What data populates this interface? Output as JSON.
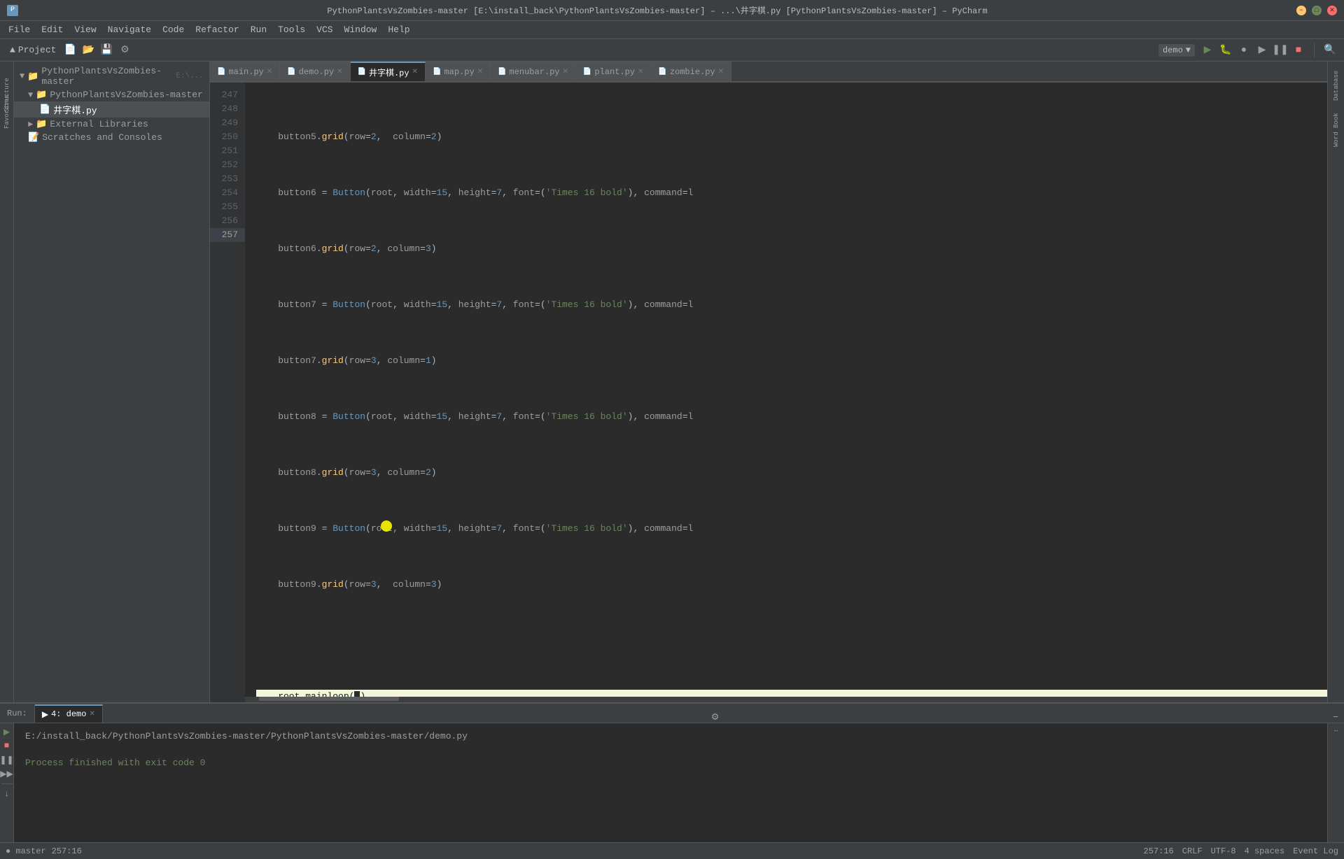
{
  "titlebar": {
    "title": "PythonPlantsVsZombies-master [E:\\install_back\\PythonPlantsVsZombies-master] – ...\\井字棋.py [PythonPlantsVsZombies-master] – PyCharm",
    "app": "PyCharm"
  },
  "menubar": {
    "items": [
      "File",
      "Edit",
      "View",
      "Navigate",
      "Code",
      "Refactor",
      "Run",
      "Tools",
      "VCS",
      "Window",
      "Help"
    ]
  },
  "toolbar": {
    "project_label": "Project",
    "run_config": "demo"
  },
  "sidebar": {
    "project_root": "PythonPlantsVsZombies-master",
    "project_path": "E:\\...",
    "sub_root": "PythonPlantsVsZombies-master",
    "active_file": "井字棋.py",
    "external_libraries": "External Libraries",
    "scratches": "Scratches and Consoles"
  },
  "tabs": [
    {
      "label": "main.py",
      "active": false,
      "closable": true
    },
    {
      "label": "demo.py",
      "active": false,
      "closable": true
    },
    {
      "label": "井字棋.py",
      "active": true,
      "closable": true
    },
    {
      "label": "map.py",
      "active": false,
      "closable": true
    },
    {
      "label": "menubar.py",
      "active": false,
      "closable": true
    },
    {
      "label": "plant.py",
      "active": false,
      "closable": true
    },
    {
      "label": "zombie.py",
      "active": false,
      "closable": true
    }
  ],
  "code_lines": [
    {
      "num": 247,
      "content": "    button5.grid(row=2,  column=2)"
    },
    {
      "num": 248,
      "content": "    button6 = Button(root, width=15, height=7, font=('Times 16 bold'), command=l"
    },
    {
      "num": 249,
      "content": "    button6.grid(row=2, column=3)"
    },
    {
      "num": 250,
      "content": "    button7 = Button(root, width=15, height=7, font=('Times 16 bold'), command=l"
    },
    {
      "num": 251,
      "content": "    button7.grid(row=3, column=1)"
    },
    {
      "num": 252,
      "content": "    button8 = Button(root, width=15, height=7, font=('Times 16 bold'), command=l"
    },
    {
      "num": 253,
      "content": "    button8.grid(row=3, column=2)"
    },
    {
      "num": 254,
      "content": "    button9 = Button(root, width=15, height=7, font=('Times 16 bold'), command=l"
    },
    {
      "num": 255,
      "content": "    button9.grid(row=3, column=3)"
    },
    {
      "num": 256,
      "content": ""
    },
    {
      "num": 257,
      "content": "    root.mainloop()"
    }
  ],
  "bottom_panel": {
    "tabs": [
      {
        "label": "Run:",
        "active": false
      },
      {
        "label": "4: demo",
        "active": true,
        "closable": true
      }
    ],
    "run_path": "E:/install_back/PythonPlantsVsZombies-master/PythonPlantsVsZombies-master/demo.py",
    "run_result": "Process finished with exit code 0"
  },
  "statusbar": {
    "line_col": "257:16",
    "crlf": "CRLF",
    "encoding": "UTF-8",
    "indent": "4 spaces",
    "event_log": "Event Log"
  }
}
